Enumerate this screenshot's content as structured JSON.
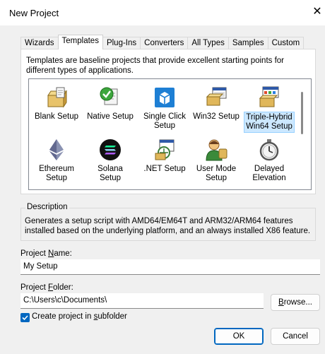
{
  "window": {
    "title": "New Project",
    "close_glyph": "✕"
  },
  "tabs": [
    {
      "label": "Wizards"
    },
    {
      "label": "Templates",
      "active": true
    },
    {
      "label": "Plug-Ins"
    },
    {
      "label": "Converters"
    },
    {
      "label": "All Types"
    },
    {
      "label": "Samples"
    },
    {
      "label": "Custom"
    }
  ],
  "templates_panel": {
    "description": "Templates are baseline projects that provide excellent starting points for different types of applications.",
    "items": [
      {
        "icon": "blank-setup-icon",
        "label": "Blank Setup"
      },
      {
        "icon": "native-setup-icon",
        "label": "Native Setup"
      },
      {
        "icon": "single-click-setup-icon",
        "label": "Single Click Setup"
      },
      {
        "icon": "win32-setup-icon",
        "label": "Win32 Setup"
      },
      {
        "icon": "triple-hybrid-win64-setup-icon",
        "label": "Triple-Hybrid Win64 Setup",
        "selected": true
      },
      {
        "icon": "ethereum-setup-icon",
        "label": "Ethereum Setup"
      },
      {
        "icon": "solana-setup-icon",
        "label": "Solana Setup"
      },
      {
        "icon": "net-setup-icon",
        "label": ".NET Setup"
      },
      {
        "icon": "user-mode-setup-icon",
        "label": "User Mode Setup"
      },
      {
        "icon": "delayed-elevation-icon",
        "label": "Delayed Elevation"
      }
    ]
  },
  "description_group": {
    "legend": "Description",
    "text": "Generates a setup script with AMD64/EM64T and ARM32/ARM64 features installed based on the underlying platform, and an always installed X86 feature."
  },
  "project_name": {
    "label_pre": "Project ",
    "label_mnemonic": "N",
    "label_post": "ame:",
    "value": "My Setup"
  },
  "project_folder": {
    "label_pre": "Project ",
    "label_mnemonic": "F",
    "label_post": "older:",
    "value": "C:\\Users\\c\\Documents\\",
    "browse_mnemonic": "B",
    "browse_rest": "rowse..."
  },
  "subfolder_checkbox": {
    "label_pre": "Create project in ",
    "label_mnemonic": "s",
    "label_post": "ubfolder",
    "checked": true
  },
  "buttons": {
    "ok": "OK",
    "cancel": "Cancel"
  },
  "colors": {
    "accent": "#0067c0",
    "selection_fill": "#cce8ff",
    "selection_border": "#99d1ff"
  }
}
